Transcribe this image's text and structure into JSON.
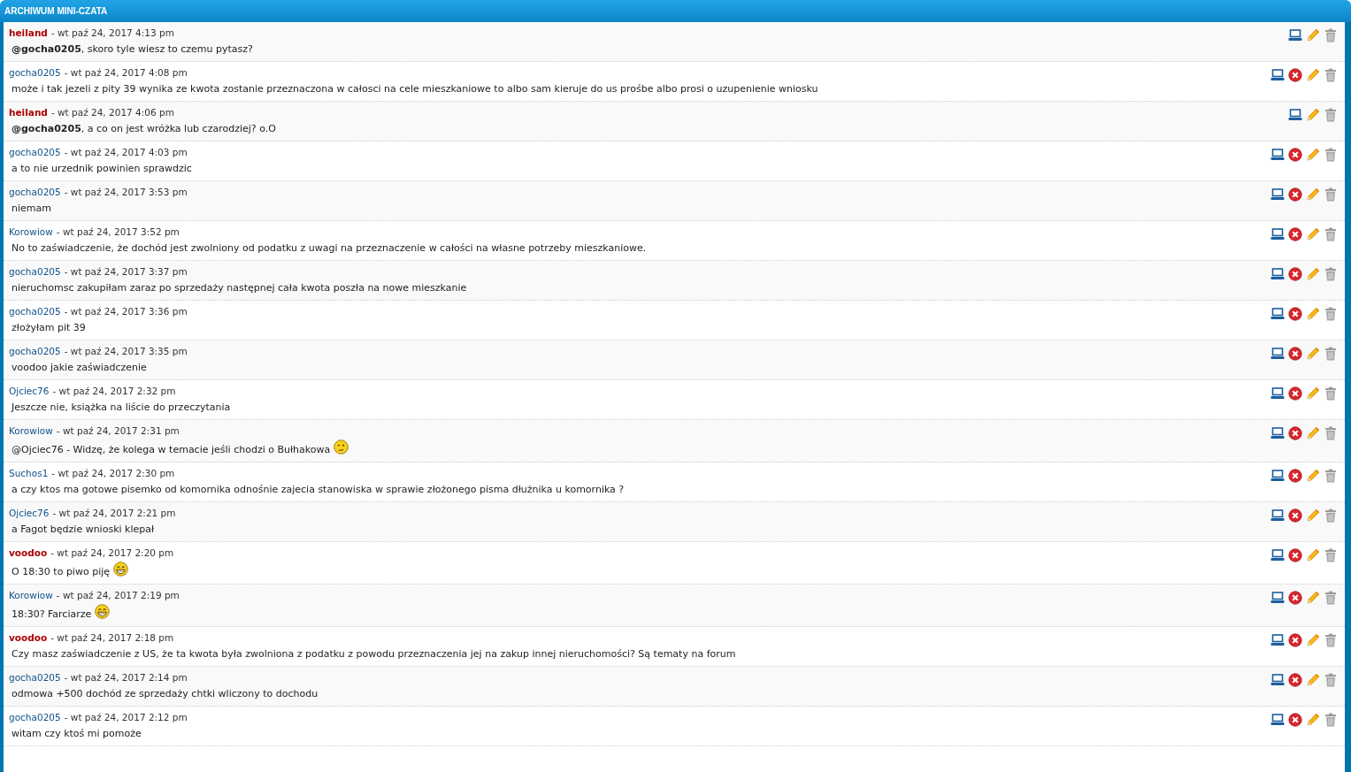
{
  "panel": {
    "title": "ARCHIWUM MINI-CZATA"
  },
  "messages": [
    {
      "author": "heiland",
      "kind": "admin",
      "date": "- wt paź 24, 2017 4:13 pm",
      "text": "**@gocha0205**, skoro tyle wiesz to czemu pytasz?",
      "removable": false
    },
    {
      "author": "gocha0205",
      "kind": "user",
      "date": "- wt paź 24, 2017 4:08 pm",
      "text": "może i tak jezeli z pity 39 wynika ze kwota zostanie przeznaczona w całosci na cele mieszkaniowe to albo sam kieruje do us prośbe albo prosi o uzupenienie wniosku",
      "removable": true
    },
    {
      "author": "heiland",
      "kind": "admin",
      "date": "- wt paź 24, 2017 4:06 pm",
      "text": "**@gocha0205**, a co on jest wróżka lub czarodziej? o.O",
      "removable": false
    },
    {
      "author": "gocha0205",
      "kind": "user",
      "date": "- wt paź 24, 2017 4:03 pm",
      "text": "a to nie urzednik powinien sprawdzic",
      "removable": true
    },
    {
      "author": "gocha0205",
      "kind": "user",
      "date": "- wt paź 24, 2017 3:53 pm",
      "text": "niemam",
      "removable": true
    },
    {
      "author": "Korowiow",
      "kind": "user",
      "date": "- wt paź 24, 2017 3:52 pm",
      "text": "No to zaświadczenie, że dochód jest zwolniony od podatku z uwagi na przeznaczenie w całości na własne potrzeby mieszkaniowe.",
      "removable": true
    },
    {
      "author": "gocha0205",
      "kind": "user",
      "date": "- wt paź 24, 2017 3:37 pm",
      "text": "nieruchomsc zakupiłam zaraz po sprzedaży następnej cała kwota poszła na nowe mieszkanie",
      "removable": true
    },
    {
      "author": "gocha0205",
      "kind": "user",
      "date": "- wt paź 24, 2017 3:36 pm",
      "text": "złożyłam pit 39",
      "removable": true
    },
    {
      "author": "gocha0205",
      "kind": "user",
      "date": "- wt paź 24, 2017 3:35 pm",
      "text": "voodoo jakie zaświadczenie",
      "removable": true
    },
    {
      "author": "Ojciec76",
      "kind": "user",
      "date": "- wt paź 24, 2017 2:32 pm",
      "text": "Jeszcze nie, książka na liście do przeczytania",
      "removable": true
    },
    {
      "author": "Korowiow",
      "kind": "user",
      "date": "- wt paź 24, 2017 2:31 pm",
      "text": "@Ojciec76 - Widzę, że kolega w temacie jeśli chodzi o Bułhakowa",
      "removable": true,
      "smiley": {
        "kind": "wink"
      }
    },
    {
      "author": "Suchos1",
      "kind": "user",
      "date": "- wt paź 24, 2017 2:30 pm",
      "text": "a czy ktos ma gotowe pisemko od komornika odnośnie zajecia stanowiska w sprawie złożonego pisma dłużnika u komornika ?",
      "removable": true
    },
    {
      "author": "Ojciec76",
      "kind": "user",
      "date": "- wt paź 24, 2017 2:21 pm",
      "text": "a Fagot będzie wnioski klepał",
      "removable": true
    },
    {
      "author": "voodoo",
      "kind": "admin",
      "date": "- wt paź 24, 2017 2:20 pm",
      "text": "O 18:30 to piwo piję",
      "removable": true,
      "smiley": {
        "kind": "grin"
      }
    },
    {
      "author": "Korowiow",
      "kind": "user",
      "date": "- wt paź 24, 2017 2:19 pm",
      "text": "18:30? Farciarze",
      "removable": true,
      "smiley": {
        "kind": "grin"
      }
    },
    {
      "author": "voodoo",
      "kind": "admin",
      "date": "- wt paź 24, 2017 2:18 pm",
      "text": "Czy masz zaświadczenie z US, że ta kwota była zwolniona z podatku z powodu przeznaczenia jej na zakup innej nieruchomości? Są tematy na forum",
      "removable": true
    },
    {
      "author": "gocha0205",
      "kind": "user",
      "date": "- wt paź 24, 2017 2:14 pm",
      "text": "odmowa +500 dochód ze sprzedaży chtki wliczony to dochodu",
      "removable": true
    },
    {
      "author": "gocha0205",
      "kind": "user",
      "date": "- wt paź 24, 2017 2:12 pm",
      "text": "witam czy ktoś mi pomoże",
      "removable": true
    }
  ]
}
